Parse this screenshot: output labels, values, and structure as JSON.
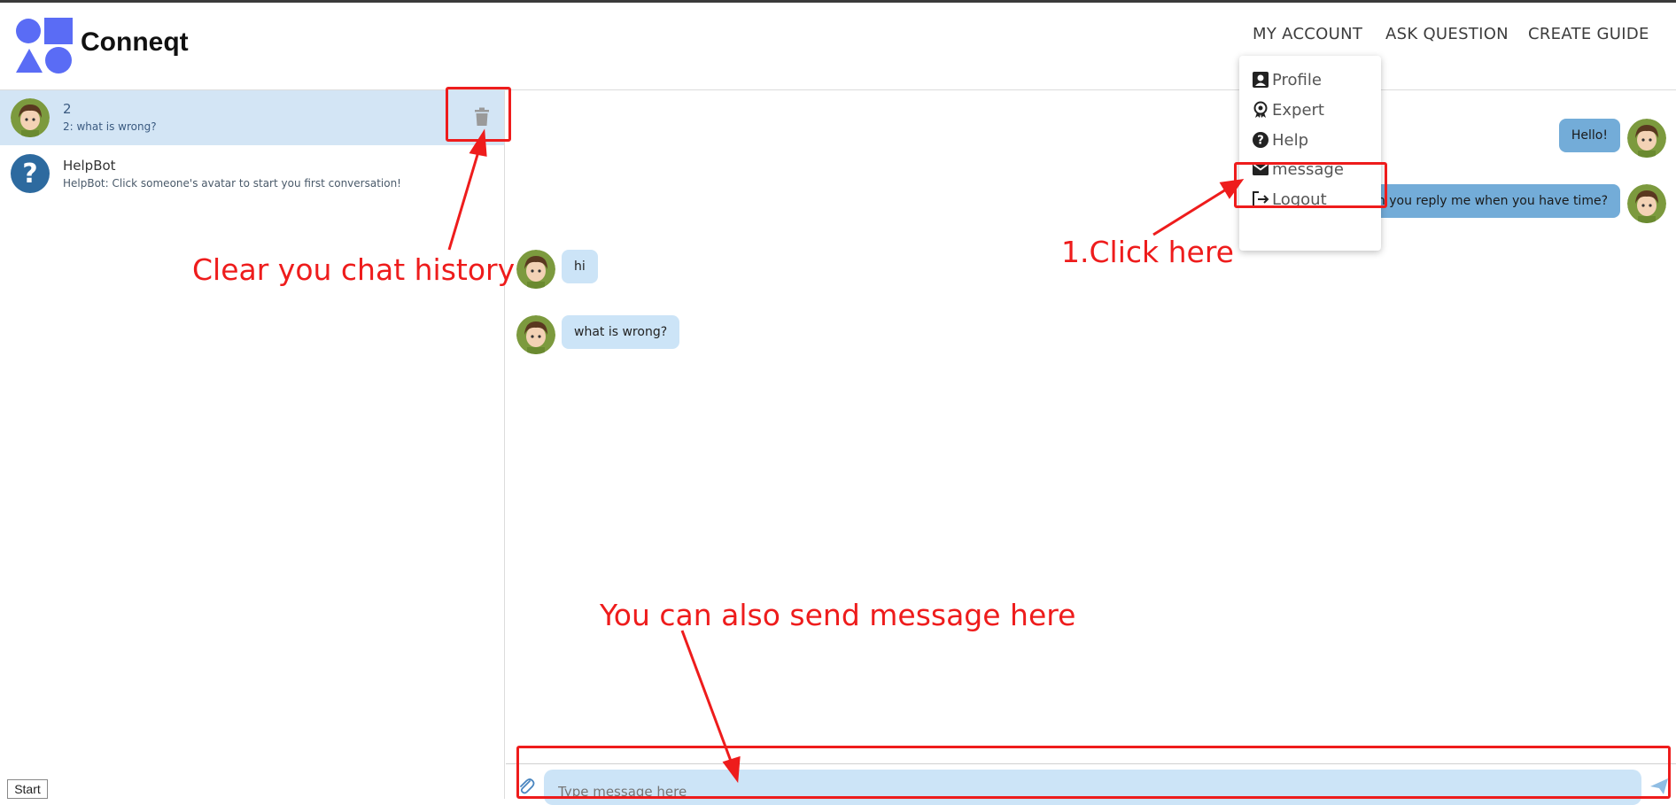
{
  "app": {
    "brand": "Conneqt"
  },
  "nav": {
    "my_account": "MY ACCOUNT",
    "ask_question": "ASK QUESTION",
    "create_guide": "CREATE GUIDE"
  },
  "account_menu": {
    "items": [
      {
        "label": "Profile",
        "icon": "profile-icon"
      },
      {
        "label": "Expert",
        "icon": "award-icon"
      },
      {
        "label": "Help",
        "icon": "help-icon"
      },
      {
        "label": "message",
        "icon": "mail-icon"
      },
      {
        "label": "Logout",
        "icon": "logout-icon"
      }
    ]
  },
  "conversations": [
    {
      "name": "2",
      "preview": "2: what is wrong?",
      "active": true
    },
    {
      "name": "HelpBot",
      "preview": "HelpBot: Click someone's avatar to start you first conversation!",
      "active": false
    }
  ],
  "messages": [
    {
      "text": "Hello!",
      "direction": "out"
    },
    {
      "text": "Can you reply me when you have time?",
      "direction": "out"
    },
    {
      "text": "hi",
      "direction": "in"
    },
    {
      "text": "what is wrong?",
      "direction": "in"
    }
  ],
  "composer": {
    "placeholder": "Type message here"
  },
  "annotations": {
    "clear_history": "Clear you chat history",
    "click_here": "1.Click here",
    "send_here": "You can also send message here"
  },
  "taskbar": {
    "start": "Start"
  },
  "colors": {
    "active_row": "#d3e5f5",
    "bubble_in": "#cce4f7",
    "bubble_out": "#73acd8",
    "annotation": "#ee1c1c",
    "logo": "#5a6cf5",
    "helpbot": "#2d6a9f"
  }
}
